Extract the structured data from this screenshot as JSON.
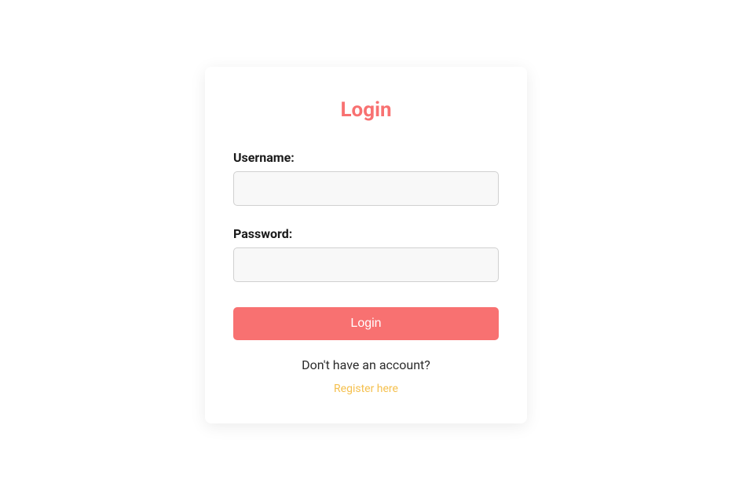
{
  "title": "Login",
  "form": {
    "username": {
      "label": "Username:",
      "value": ""
    },
    "password": {
      "label": "Password:",
      "value": ""
    },
    "submit_label": "Login"
  },
  "footer": {
    "prompt": "Don't have an account?",
    "register_link": "Register here"
  },
  "colors": {
    "accent": "#f87171",
    "link": "#f5c04e"
  }
}
